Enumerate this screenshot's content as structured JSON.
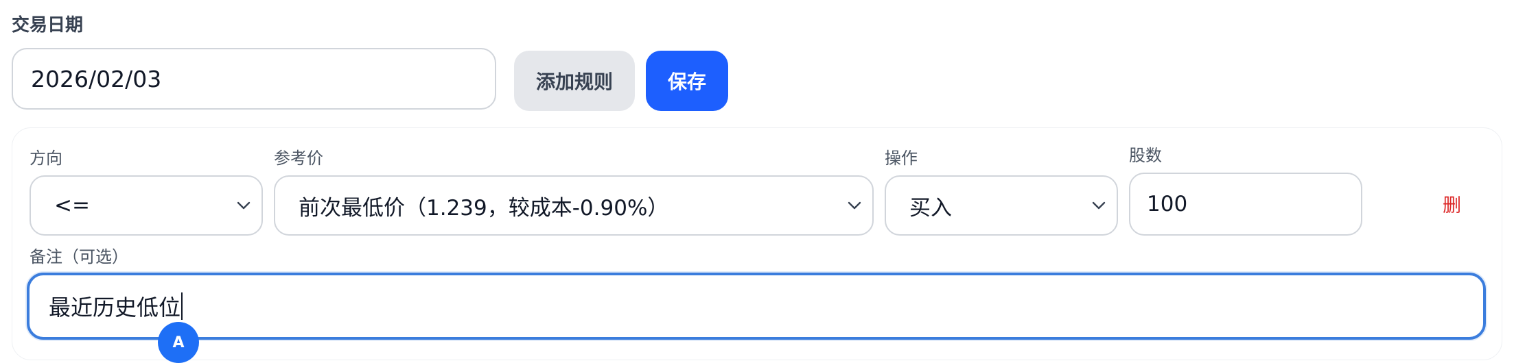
{
  "form": {
    "date_label": "交易日期",
    "date_value": "2026/02/03",
    "add_rule_label": "添加规则",
    "save_label": "保存"
  },
  "rule": {
    "direction": {
      "label": "方向",
      "value": "<="
    },
    "reference_price": {
      "label": "参考价",
      "value": "前次最低价（1.239，较成本-0.90%）"
    },
    "action": {
      "label": "操作",
      "value": "买入"
    },
    "shares": {
      "label": "股数",
      "value": "100"
    },
    "delete_label": "删",
    "note": {
      "label": "备注（可选）",
      "value": "最近历史低位"
    }
  },
  "ime_indicator": "A",
  "icons": {
    "select_arrow": "chevron-down-icon"
  },
  "colors": {
    "primary": "#1d5ffe",
    "danger": "#dc2626",
    "focus_border": "#3b7ddd",
    "secondary_button": "#e5e7eb"
  }
}
